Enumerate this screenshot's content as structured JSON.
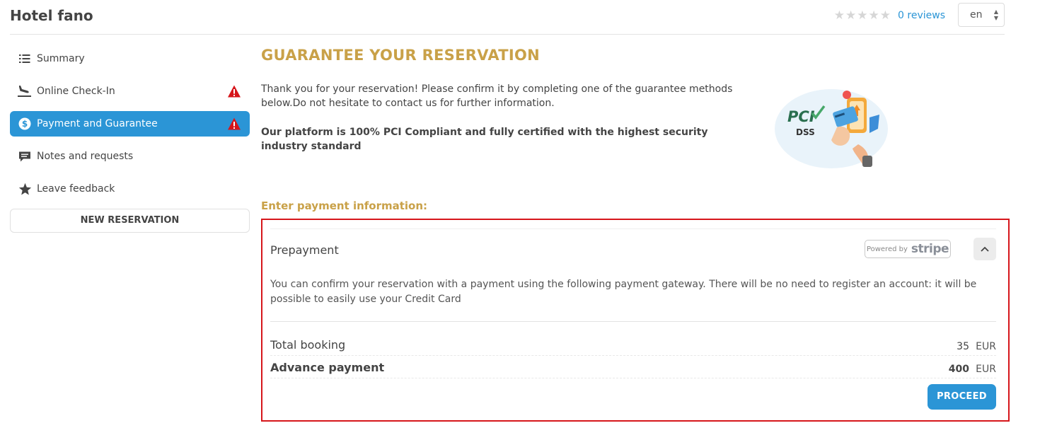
{
  "header": {
    "title": "Hotel fano",
    "rating": {
      "stars_filled": 0,
      "stars_total": 5,
      "reviews_label": "0 reviews"
    },
    "language": "en"
  },
  "sidebar": {
    "items": [
      {
        "label": "Summary",
        "icon": "list-icon",
        "active": false,
        "warning": false
      },
      {
        "label": "Online Check-In",
        "icon": "plane-landing-icon",
        "active": false,
        "warning": true
      },
      {
        "label": "Payment and Guarantee",
        "icon": "dollar-circle-icon",
        "active": true,
        "warning": true
      },
      {
        "label": "Notes and requests",
        "icon": "comment-icon",
        "active": false,
        "warning": false
      },
      {
        "label": "Leave feedback",
        "icon": "star-icon",
        "active": false,
        "warning": false
      }
    ],
    "new_reservation_label": "NEW RESERVATION"
  },
  "main": {
    "title": "GUARANTEE YOUR RESERVATION",
    "intro": "Thank you for your reservation! Please confirm it by completing one of the guarantee methods below.Do not hesitate to contact us for further information.",
    "compliance": "Our platform is 100% PCI Compliant and fully certified with the highest security industry standard",
    "pci_badge": {
      "line1": "PCI",
      "line2": "DSS"
    },
    "payment_section_label": "Enter payment information:",
    "payment": {
      "method_title": "Prepayment",
      "stripe_badge": {
        "prefix": "Powered by",
        "brand": "stripe"
      },
      "description": "You can confirm your reservation with a payment using the following payment gateway. There will be no need to register an account: it will be possible to easily use your Credit Card",
      "total_label": "Total booking",
      "total_value": "35",
      "advance_label": "Advance payment",
      "advance_value": "400",
      "currency": "EUR",
      "proceed_label": "PROCEED"
    }
  },
  "colors": {
    "accent_blue": "#2b95d6",
    "gold": "#c9a148",
    "warning_red": "#d6161b",
    "highlight_border": "#d6161b"
  }
}
